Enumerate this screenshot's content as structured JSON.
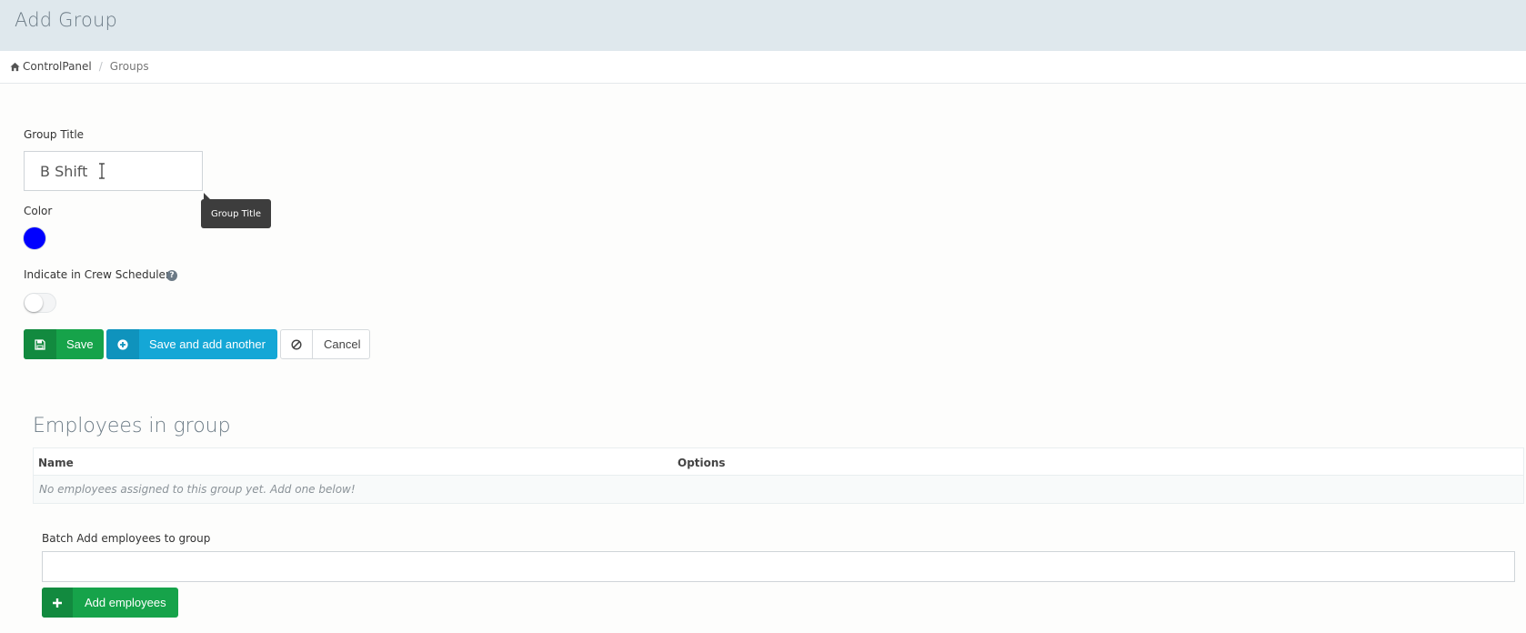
{
  "header": {
    "title": "Add Group"
  },
  "breadcrumb": {
    "home_label": "ControlPanel",
    "current_label": "Groups"
  },
  "form": {
    "group_title_label": "Group Title",
    "group_title_value": "B Shift",
    "tooltip_text": "Group Title",
    "color_label": "Color",
    "color_value": "#0000ff",
    "crew_scheduler_label": "Indicate in Crew Scheduler",
    "crew_scheduler_enabled": false,
    "help_glyph": "?"
  },
  "actions": {
    "save_label": "Save",
    "save_add_label": "Save and add another",
    "cancel_label": "Cancel"
  },
  "employees": {
    "section_title": "Employees in group",
    "columns": [
      "Name",
      "Options"
    ],
    "empty_text": "No employees assigned to this group yet. Add one below!",
    "batch_label": "Batch Add employees to group",
    "batch_value": "",
    "add_button_label": "Add employees"
  },
  "icons": {
    "home": "home-icon",
    "save": "floppy-disk-icon",
    "save_add": "plus-circle-icon",
    "cancel": "ban-icon",
    "add": "plus-icon",
    "help": "question-circle-icon"
  },
  "colors": {
    "success": "#16a34a",
    "info": "#14a7d6",
    "header_bg": "#dfe8ed"
  }
}
